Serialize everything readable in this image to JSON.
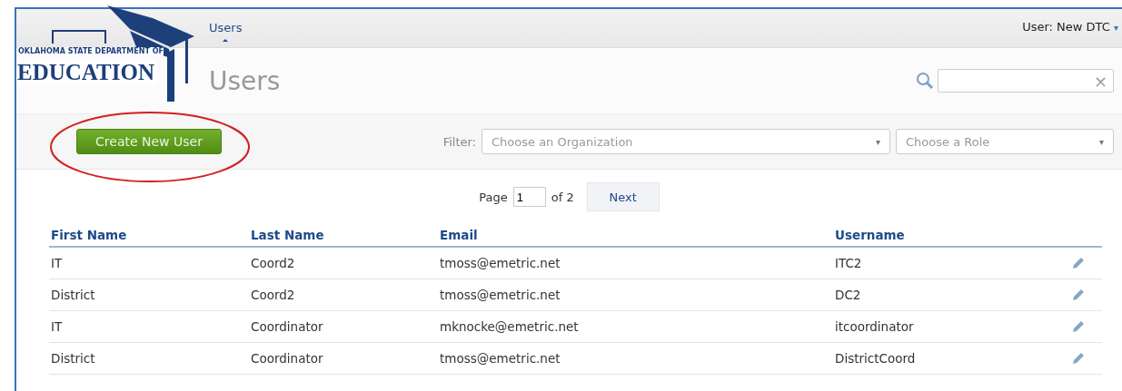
{
  "logo": {
    "subtitle": "OKLAHOMA STATE DEPARTMENT OF",
    "title": "EDUCATION"
  },
  "nav": [
    {
      "label": "Users",
      "selected": true
    }
  ],
  "user_menu": {
    "label": "User: New DTC",
    "caret": "▾"
  },
  "page_title": "Users",
  "search": {
    "clear": "×"
  },
  "create_button": {
    "label": "Create New User",
    "annotated": true
  },
  "filter": {
    "label": "Filter:",
    "selects": [
      {
        "placeholder": "Choose an Organization",
        "arrow": "▾"
      },
      {
        "placeholder": "Choose a Role",
        "arrow": "▾"
      }
    ]
  },
  "pager": {
    "page_label": "Page",
    "page": "1",
    "of_label": "of 2",
    "next": "Next"
  },
  "table": {
    "columns": [
      "First Name",
      "Last Name",
      "Email",
      "Username"
    ],
    "rows": [
      {
        "cells": [
          "IT",
          "Coord2",
          "tmoss@emetric.net",
          "ITC2"
        ]
      },
      {
        "cells": [
          "District",
          "Coord2",
          "tmoss@emetric.net",
          "DC2"
        ]
      },
      {
        "cells": [
          "IT",
          "Coordinator",
          "mknocke@emetric.net",
          "itcoordinator"
        ]
      },
      {
        "cells": [
          "District",
          "Coordinator",
          "tmoss@emetric.net",
          "DistrictCoord"
        ]
      }
    ]
  }
}
